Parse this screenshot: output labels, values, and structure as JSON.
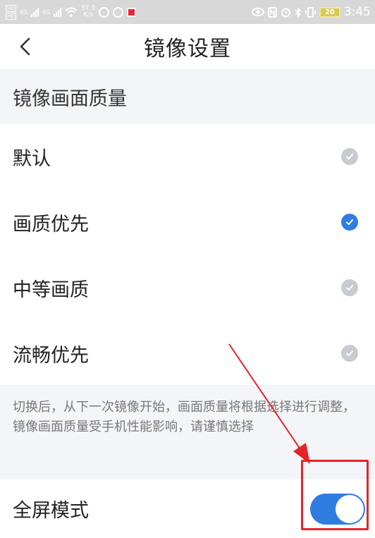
{
  "status_bar": {
    "hd_top": "HD",
    "hd_bottom": "HD",
    "network_1": "4G",
    "network_2": "4G",
    "speed_value": "57.5",
    "speed_unit": "K/s",
    "battery": "20",
    "time": "3:45"
  },
  "header": {
    "title": "镜像设置"
  },
  "quality_section": {
    "title": "镜像画面质量",
    "options": [
      {
        "label": "默认",
        "selected": false
      },
      {
        "label": "画质优先",
        "selected": true
      },
      {
        "label": "中等画质",
        "selected": false
      },
      {
        "label": "流畅优先",
        "selected": false
      }
    ],
    "note": "切换后，从下一次镜像开始，画面质量将根据选择进行调整，镜像画面质量受手机性能影响，请谨慎选择"
  },
  "fullscreen": {
    "label": "全屏模式",
    "enabled": true
  },
  "colors": {
    "accent": "#2f7de1",
    "check_inactive": "#c8cbd0",
    "annotation": "#e5232a"
  }
}
